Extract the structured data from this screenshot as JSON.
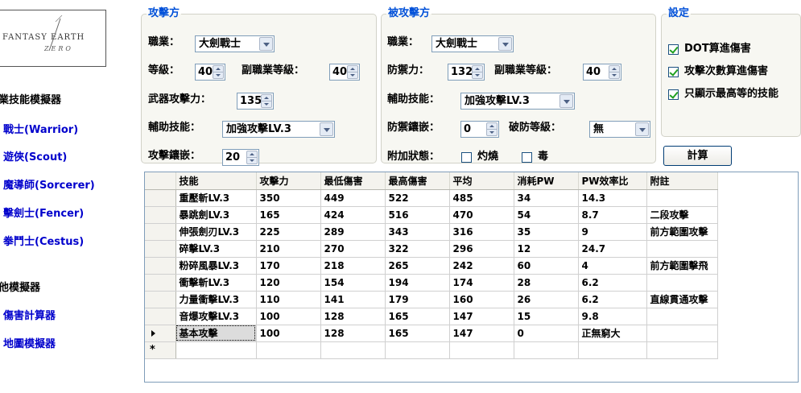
{
  "logo": {
    "text_top": "FANTASY EARTH",
    "text_bottom": "ZERO"
  },
  "sidebar": {
    "heading_skill_sim": "業技能模擬器",
    "classes": [
      {
        "label": "戰士(Warrior)"
      },
      {
        "label": "遊俠(Scout)"
      },
      {
        "label": "魔導師(Sorcerer)"
      },
      {
        "label": "擊劍士(Fencer)"
      },
      {
        "label": "拳鬥士(Cestus)"
      }
    ],
    "heading_other_sim": "他模擬器",
    "tools": [
      {
        "label": "傷害計算器"
      },
      {
        "label": "地圖模擬器"
      }
    ]
  },
  "attacker": {
    "legend": "攻擊方",
    "job_label": "職業：",
    "job_value": "大劍戰士",
    "level_label": "等級：",
    "level_value": "40",
    "sub_level_label": "副職業等級：",
    "sub_level_value": "40",
    "weapon_atk_label": "武器攻擊力：",
    "weapon_atk_value": "135",
    "support_label": "輔助技能：",
    "support_value": "加強攻擊LV.3",
    "inlay_label": "攻擊鑲嵌：",
    "inlay_value": "20"
  },
  "defender": {
    "legend": "被攻擊方",
    "job_label": "職業：",
    "job_value": "大劍戰士",
    "def_label": "防禦力：",
    "def_value": "132",
    "sub_level_label": "副職業等級：",
    "sub_level_value": "40",
    "support_label": "輔助技能：",
    "support_value": "加強攻擊LV.3",
    "inlay_label": "防禦鑲嵌：",
    "inlay_value": "0",
    "pierce_label": "破防等級：",
    "pierce_value": "無",
    "status_label": "附加狀態：",
    "burn_label": "灼燒",
    "burn_checked": false,
    "poison_label": "毒",
    "poison_checked": false
  },
  "settings": {
    "legend": "設定",
    "options": [
      {
        "label": "DOT算進傷害",
        "checked": true
      },
      {
        "label": "攻擊次數算進傷害",
        "checked": true
      },
      {
        "label": "只顯示最高等的技能",
        "checked": true
      }
    ],
    "calc_button": "計算"
  },
  "table": {
    "columns": [
      "技能",
      "攻擊力",
      "最低傷害",
      "最高傷害",
      "平均",
      "消耗PW",
      "PW效率比",
      "附註"
    ],
    "rows": [
      [
        "重壓斬LV.3",
        "350",
        "449",
        "522",
        "485",
        "34",
        "14.3",
        ""
      ],
      [
        "暴跳劍LV.3",
        "165",
        "424",
        "516",
        "470",
        "54",
        "8.7",
        "二段攻擊"
      ],
      [
        "伸張劍刃LV.3",
        "225",
        "289",
        "343",
        "316",
        "35",
        "9",
        "前方範圍攻擊"
      ],
      [
        "碎擊LV.3",
        "210",
        "270",
        "322",
        "296",
        "12",
        "24.7",
        ""
      ],
      [
        "粉碎風暴LV.3",
        "170",
        "218",
        "265",
        "242",
        "60",
        "4",
        "前方範圍擊飛"
      ],
      [
        "衝擊斬LV.3",
        "120",
        "154",
        "194",
        "174",
        "28",
        "6.2",
        ""
      ],
      [
        "力量衝擊LV.3",
        "110",
        "141",
        "179",
        "160",
        "26",
        "6.2",
        "直線貫通攻擊"
      ],
      [
        "音爆攻擊LV.3",
        "100",
        "128",
        "165",
        "147",
        "15",
        "9.8",
        ""
      ],
      [
        "基本攻擊",
        "100",
        "128",
        "165",
        "147",
        "0",
        "正無窮大",
        ""
      ]
    ],
    "current_row": 8,
    "new_row_marker": "*"
  },
  "colors": {
    "legend": "#0050d8",
    "link": "#0000cc",
    "group_bg": "#f7f7f2"
  }
}
